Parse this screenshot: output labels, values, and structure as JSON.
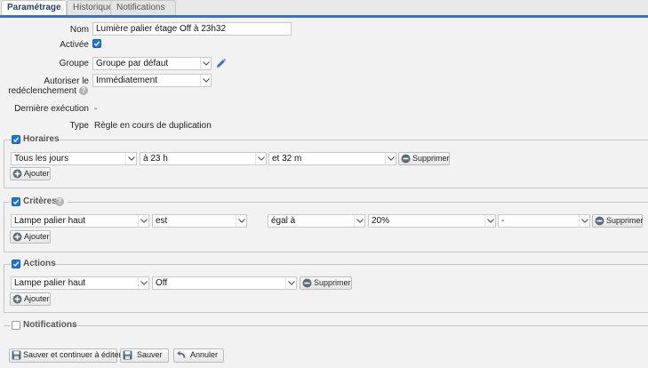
{
  "tabs": [
    {
      "label": "Paramétrage"
    },
    {
      "label": "Historique"
    },
    {
      "label": "Notifications"
    }
  ],
  "form": {
    "name": {
      "label": "Nom",
      "value": "Lumière palier étage Off à 23h32"
    },
    "active": {
      "label": "Activée",
      "checked": true
    },
    "group": {
      "label": "Groupe",
      "value": "Groupe par défaut"
    },
    "retrigger": {
      "label_line1": "Autoriser le",
      "label_line2": "redéclenchement",
      "value": "Immédiatement"
    },
    "last_exec": {
      "label": "Dernière exécution",
      "value": "-"
    },
    "type": {
      "label": "Type",
      "value": "Règle en cours de duplication"
    }
  },
  "horaires": {
    "legend": "Horaires",
    "enabled": true,
    "row": {
      "days": "Tous les jours",
      "hour": "à 23 h",
      "minute": "et 32 m",
      "remove_label": "Supprimer"
    },
    "add_label": "Ajouter"
  },
  "criteres": {
    "legend": "Critères",
    "enabled": true,
    "row": {
      "device": "Lampe palier haut",
      "verb": "est",
      "operator": "égal à",
      "value": "20%",
      "extra": "-",
      "remove_label": "Supprimer"
    },
    "add_label": "Ajouter"
  },
  "actions": {
    "legend": "Actions",
    "enabled": true,
    "row": {
      "device": "Lampe palier haut",
      "action": "Off",
      "remove_label": "Supprimer"
    },
    "add_label": "Ajouter"
  },
  "notifications": {
    "legend": "Notifications",
    "enabled": false
  },
  "footer": {
    "save_continue_label": "Sauver et continuer à éditer",
    "save_label": "Sauver",
    "cancel_label": "Annuler"
  }
}
